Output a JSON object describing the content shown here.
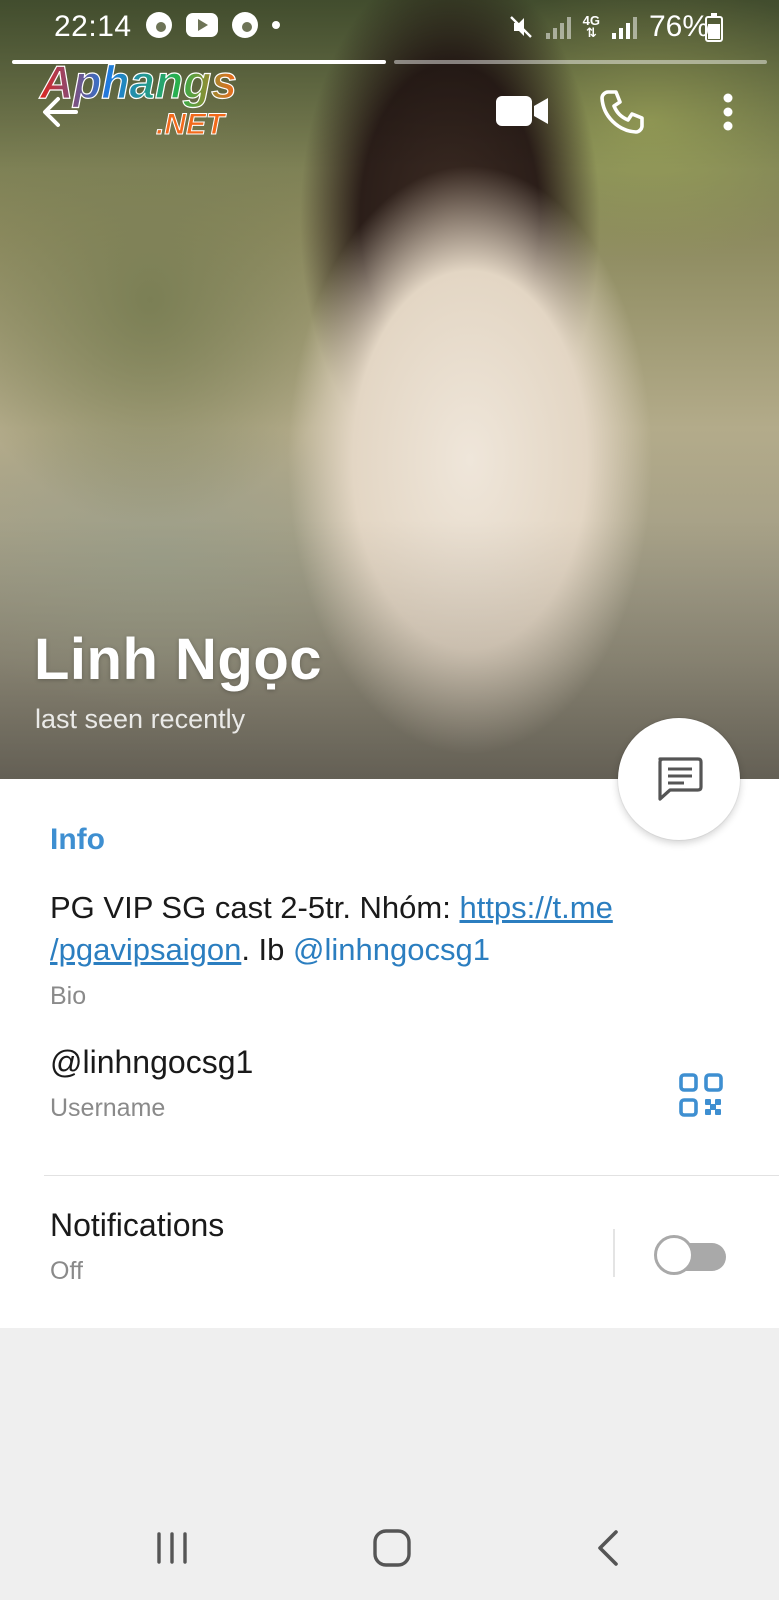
{
  "status_bar": {
    "time": "22:14",
    "network": "4G",
    "battery": "76%",
    "battery_level": 0.76
  },
  "watermark": {
    "line1": "Aphangs",
    "line2": ".NET"
  },
  "story": {
    "segments": 2,
    "active_index": 0
  },
  "actions": {
    "back_icon": "arrow-left-icon",
    "video_icon": "video-camera-icon",
    "call_icon": "phone-icon",
    "more_icon": "more-vertical-icon",
    "message_icon": "message-icon"
  },
  "profile": {
    "name": "Linh Ngọc",
    "status": "last seen recently"
  },
  "info": {
    "section_title": "Info",
    "bio": {
      "text_before": "PG VIP SG cast 2-5tr. Nhóm: ",
      "link_line1": "https://t.me",
      "link_line2": "/pgavipsaigon",
      "text_middle": ". Ib ",
      "mention": "@linhngocsg1",
      "label": "Bio"
    },
    "username": {
      "value": "@linhngocsg1",
      "label": "Username",
      "qr_icon": "qr-code-icon"
    },
    "notifications": {
      "title": "Notifications",
      "value": "Off",
      "enabled": false
    }
  },
  "colors": {
    "accent": "#3e8fd1",
    "link": "#2b7ec0",
    "secondary_text": "#8a8a8a",
    "page_bg": "#efefef"
  },
  "nav": {
    "recents_icon": "recents-icon",
    "home_icon": "home-icon",
    "back_icon": "back-chevron-icon"
  }
}
